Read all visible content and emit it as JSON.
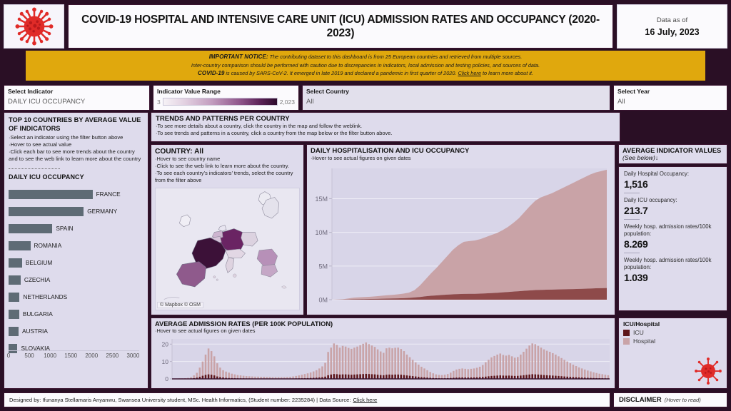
{
  "header": {
    "logo_icon": "coronavirus-icon",
    "title": "COVID-19 HOSPITAL AND INTENSIVE CARE UNIT (ICU) ADMISSION RATES AND OCCUPANCY (2020-2023)",
    "data_as_of_label": "Data as of",
    "data_as_of_value": "16 July, 2023"
  },
  "notice": {
    "line1_bold": "IMPORTANT NOTICE:",
    "line1": "The contributing dataset to this dashboard is from 25 European countries and retrieved from multiple sources.",
    "line2": "Inter-country comparison should be performed with caution due to discrepancies in indicators, local admission and testing policies, and sources of data.",
    "line3_bold": "COVID-19",
    "line3a": "is caused by SARS-CoV-2. It emerged in late 2019 and declared a pandemic in first quarter of 2020.",
    "line3_link": "Click here",
    "line3b": "to learn more about it.",
    "background": "#e0a80d"
  },
  "filters": {
    "indicator": {
      "label": "Select Indicator",
      "value": "DAILY ICU OCCUPANCY"
    },
    "range": {
      "label": "Indicator Value Range",
      "min": "3",
      "max": "2,023"
    },
    "country": {
      "label": "Select Country",
      "value": "All"
    },
    "year": {
      "label": "Select Year",
      "value": "All"
    }
  },
  "left_panel": {
    "title": "TOP 10 COUNTRIES BY AVERAGE VALUE OF INDICATORS",
    "bullets": [
      "·Select an indicator using the filter button above",
      "·Hover to see actual value",
      "·Click each bar to see more trends about the country and to see the web link to learn more about the country"
    ],
    "subtitle": "DAILY ICU OCCUPANCY"
  },
  "trends_bar": {
    "title": "TRENDS AND PATTERNS PER COUNTRY",
    "bullets": [
      "·To see more details about a country, click the country in the map and follow the weblink.",
      "·To see trends and patterns in a country, click a country from the map below or the filter button above."
    ]
  },
  "country_panel": {
    "title": "COUNTRY: All",
    "bullets": [
      "·Hover to see country name",
      "·Click to see the web link to learn more about the country.",
      "·To see each country’s indicators’ trends, select the country from the filter above"
    ],
    "map_attribution": "© Mapbox © OSM"
  },
  "area_panel": {
    "title": "DAILY HOSPITALISATION AND ICU OCCUPANCY",
    "hint": "·Hover to see actual figures on given dates"
  },
  "avg_panel": {
    "title": "AVERAGE INDICATOR VALUES",
    "subtitle": "(See below)↓",
    "kpis": [
      {
        "label": "Daily Hospital Occupancy:",
        "value": "1,516"
      },
      {
        "label": "Daily ICU occupancy:",
        "value": "213.7"
      },
      {
        "label": "Weekly hosp. admission rates/100k population:",
        "value": "8.269"
      },
      {
        "label": "Weekly hosp. admission rates/100k population:",
        "value": "1.039"
      }
    ]
  },
  "rates_panel": {
    "title": "AVERAGE ADMISSION RATES (PER 100K POPULATION)",
    "hint": "·Hover to see actual figures on given dates"
  },
  "legend": {
    "title": "ICU/Hospital",
    "items": [
      {
        "label": "ICU",
        "color": "#5d1519"
      },
      {
        "label": "Hospital",
        "color": "#c9a3a7"
      }
    ],
    "virus_icon": "coronavirus-icon"
  },
  "footer": {
    "credit": "Designed by: Ifunanya Stellamaris Anyanwu, Swansea University student, MSc. Health Informatics, (Student number: 2235284)  |  Data Source:",
    "source_link": "Click here",
    "disclaimer_label": "DISCLAIMER",
    "disclaimer_hint": "(Hover to read)"
  },
  "colors": {
    "page_background": "#2a0f25",
    "panel_background": "#dedbec",
    "plot_background": "#dedbec",
    "bar_gray": "#5e6b75",
    "icu": "#5d1519",
    "hospital": "#c9a3a7",
    "accent_yellow": "#e0a80d",
    "virus_red": "#e02b28"
  },
  "chart_data": [
    {
      "type": "bar",
      "orientation": "horizontal",
      "title": "DAILY ICU OCCUPANCY",
      "subtitle": "TOP 10 COUNTRIES BY AVERAGE VALUE OF INDICATORS",
      "xlabel": "",
      "ylabel": "",
      "xlim": [
        0,
        3200
      ],
      "xticks": [
        0,
        500,
        1000,
        1500,
        2000,
        2500,
        3000
      ],
      "grid": false,
      "bar_color": "#5e6b75",
      "categories": [
        "FRANCE",
        "GERMANY",
        "SPAIN",
        "ROMANIA",
        "BELGIUM",
        "CZECHIA",
        "NETHERLANDS",
        "BULGARIA",
        "AUSTRIA",
        "SLOVAKIA"
      ],
      "values": [
        2023,
        1810,
        1055,
        525,
        325,
        290,
        265,
        255,
        240,
        215
      ]
    },
    {
      "type": "area",
      "stacked": true,
      "title": "DAILY HOSPITALISATION AND ICU OCCUPANCY",
      "xlabel": "",
      "ylabel": "",
      "ylim": [
        0,
        19500000
      ],
      "yticks": [
        0,
        5000000,
        10000000,
        15000000
      ],
      "ytick_labels": [
        "0M",
        "5M",
        "10M",
        "15M"
      ],
      "grid": true,
      "legend_position": "external-right",
      "x_start": "2020",
      "x_end": "2023",
      "series": [
        {
          "name": "Hospital",
          "color": "#c9a3a7",
          "values": [
            0,
            0.02,
            0.06,
            0.18,
            0.3,
            0.36,
            0.4,
            0.44,
            0.5,
            0.58,
            0.66,
            0.72,
            0.8,
            0.9,
            1.05,
            1.4,
            2.1,
            3.0,
            3.9,
            4.7,
            5.6,
            6.5,
            7.4,
            8.1,
            8.6,
            8.7,
            8.8,
            9.0,
            9.3,
            9.6,
            9.9,
            10.3,
            10.8,
            11.4,
            12.1,
            13.0,
            13.9,
            14.7,
            15.2,
            15.5,
            15.8,
            16.2,
            16.6,
            17.0,
            17.4,
            17.8,
            18.2,
            18.6,
            18.9,
            19.1,
            19.3
          ]
        },
        {
          "name": "ICU",
          "color": "#8e4a4a",
          "values": [
            0,
            0.01,
            0.02,
            0.04,
            0.06,
            0.08,
            0.09,
            0.1,
            0.12,
            0.14,
            0.16,
            0.18,
            0.2,
            0.23,
            0.27,
            0.33,
            0.4,
            0.5,
            0.58,
            0.64,
            0.7,
            0.75,
            0.8,
            0.84,
            0.86,
            0.87,
            0.88,
            0.9,
            0.94,
            0.98,
            1.02,
            1.08,
            1.14,
            1.2,
            1.26,
            1.32,
            1.38,
            1.43,
            1.46,
            1.48,
            1.5,
            1.52,
            1.54,
            1.56,
            1.58,
            1.6,
            1.63,
            1.66,
            1.69,
            1.71,
            1.73
          ]
        }
      ],
      "units": "millions"
    },
    {
      "type": "bar",
      "orientation": "vertical",
      "title": "AVERAGE ADMISSION RATES (PER 100K POPULATION)",
      "xlabel": "",
      "ylabel": "",
      "ylim": [
        0,
        23
      ],
      "yticks": [
        0,
        10,
        20
      ],
      "grid": true,
      "series": [
        {
          "name": "Hospital",
          "color": "#c9a3a7",
          "values": [
            0.2,
            0.2,
            0.3,
            0.3,
            0.4,
            0.6,
            1.0,
            2.0,
            3.5,
            6.5,
            10.0,
            14.0,
            17.5,
            16.0,
            13.0,
            9.0,
            6.5,
            5.0,
            4.2,
            3.6,
            3.0,
            2.6,
            2.2,
            2.0,
            1.8,
            1.6,
            1.5,
            1.4,
            1.3,
            1.3,
            1.2,
            1.2,
            1.1,
            1.1,
            1.0,
            1.0,
            1.0,
            1.0,
            1.0,
            1.1,
            1.2,
            1.4,
            1.7,
            2.0,
            2.4,
            2.8,
            3.2,
            3.7,
            4.3,
            5.0,
            6.0,
            7.2,
            9.2,
            15.5,
            18.0,
            20.4,
            19.6,
            18.0,
            19.0,
            18.6,
            17.8,
            17.3,
            18.0,
            18.6,
            19.4,
            20.2,
            21.0,
            20.0,
            19.2,
            18.4,
            17.0,
            15.8,
            15.0,
            17.6,
            18.0,
            17.6,
            17.9,
            18.0,
            17.2,
            16.0,
            14.0,
            12.5,
            11.0,
            9.5,
            8.2,
            7.0,
            6.0,
            5.0,
            4.0,
            3.2,
            2.6,
            2.3,
            2.2,
            2.4,
            2.8,
            3.6,
            4.6,
            5.4,
            5.8,
            6.0,
            5.8,
            5.6,
            5.8,
            6.0,
            6.4,
            7.0,
            8.0,
            9.6,
            11.0,
            12.4,
            13.2,
            14.0,
            14.6,
            13.8,
            13.4,
            13.8,
            13.0,
            12.2,
            12.6,
            14.0,
            15.6,
            17.4,
            19.2,
            20.4,
            20.0,
            19.0,
            18.0,
            17.0,
            16.2,
            15.6,
            14.8,
            14.0,
            13.0,
            12.0,
            11.0,
            10.0,
            9.0,
            8.2,
            7.4,
            6.6,
            6.0,
            5.4,
            4.8,
            4.3,
            3.8,
            3.4,
            3.0,
            2.7,
            2.4,
            2.1
          ]
        },
        {
          "name": "ICU",
          "color": "#5d1519",
          "values": [
            0.05,
            0.05,
            0.08,
            0.1,
            0.1,
            0.15,
            0.25,
            0.4,
            0.7,
            1.2,
            1.8,
            2.3,
            2.6,
            2.4,
            2.0,
            1.4,
            1.0,
            0.8,
            0.6,
            0.5,
            0.45,
            0.4,
            0.35,
            0.3,
            0.3,
            0.25,
            0.25,
            0.22,
            0.2,
            0.2,
            0.2,
            0.2,
            0.18,
            0.18,
            0.16,
            0.16,
            0.16,
            0.16,
            0.16,
            0.18,
            0.2,
            0.22,
            0.26,
            0.3,
            0.35,
            0.4,
            0.46,
            0.54,
            0.62,
            0.72,
            0.85,
            1.0,
            1.3,
            2.1,
            2.5,
            2.8,
            2.7,
            2.5,
            2.6,
            2.6,
            2.5,
            2.4,
            2.5,
            2.6,
            2.7,
            2.8,
            2.9,
            2.8,
            2.7,
            2.6,
            2.4,
            2.2,
            2.1,
            2.4,
            2.5,
            2.4,
            2.5,
            2.5,
            2.4,
            2.2,
            2.0,
            1.8,
            1.6,
            1.4,
            1.2,
            1.0,
            0.9,
            0.75,
            0.6,
            0.5,
            0.4,
            0.35,
            0.33,
            0.36,
            0.42,
            0.52,
            0.65,
            0.76,
            0.8,
            0.84,
            0.8,
            0.78,
            0.8,
            0.84,
            0.9,
            1.0,
            1.1,
            1.3,
            1.5,
            1.7,
            1.8,
            1.9,
            2.0,
            1.9,
            1.85,
            1.9,
            1.8,
            1.7,
            1.75,
            1.9,
            2.1,
            2.3,
            2.5,
            2.7,
            2.6,
            2.5,
            2.35,
            2.2,
            2.1,
            2.0,
            1.9,
            1.8,
            1.7,
            1.55,
            1.4,
            1.3,
            1.15,
            1.05,
            0.95,
            0.85,
            0.78,
            0.7,
            0.62,
            0.55,
            0.5,
            0.44,
            0.4,
            0.35,
            0.3,
            0.28
          ]
        }
      ]
    }
  ],
  "map": {
    "regions": [
      {
        "name": "france",
        "fill": "#3c1138"
      },
      {
        "name": "germany",
        "fill": "#6a2463"
      },
      {
        "name": "spain",
        "fill": "#8f5a8c"
      },
      {
        "name": "romania",
        "fill": "#b790b8"
      },
      {
        "name": "bulgaria",
        "fill": "#c5a7c6"
      },
      {
        "name": "belgium",
        "fill": "#d6c2d8"
      },
      {
        "name": "netherlands",
        "fill": "#cdb4cf"
      },
      {
        "name": "ireland",
        "fill": "#f0eef5"
      },
      {
        "name": "norway",
        "fill": "#ecebf2"
      },
      {
        "name": "sweden",
        "fill": "#e4e2ec"
      }
    ]
  }
}
